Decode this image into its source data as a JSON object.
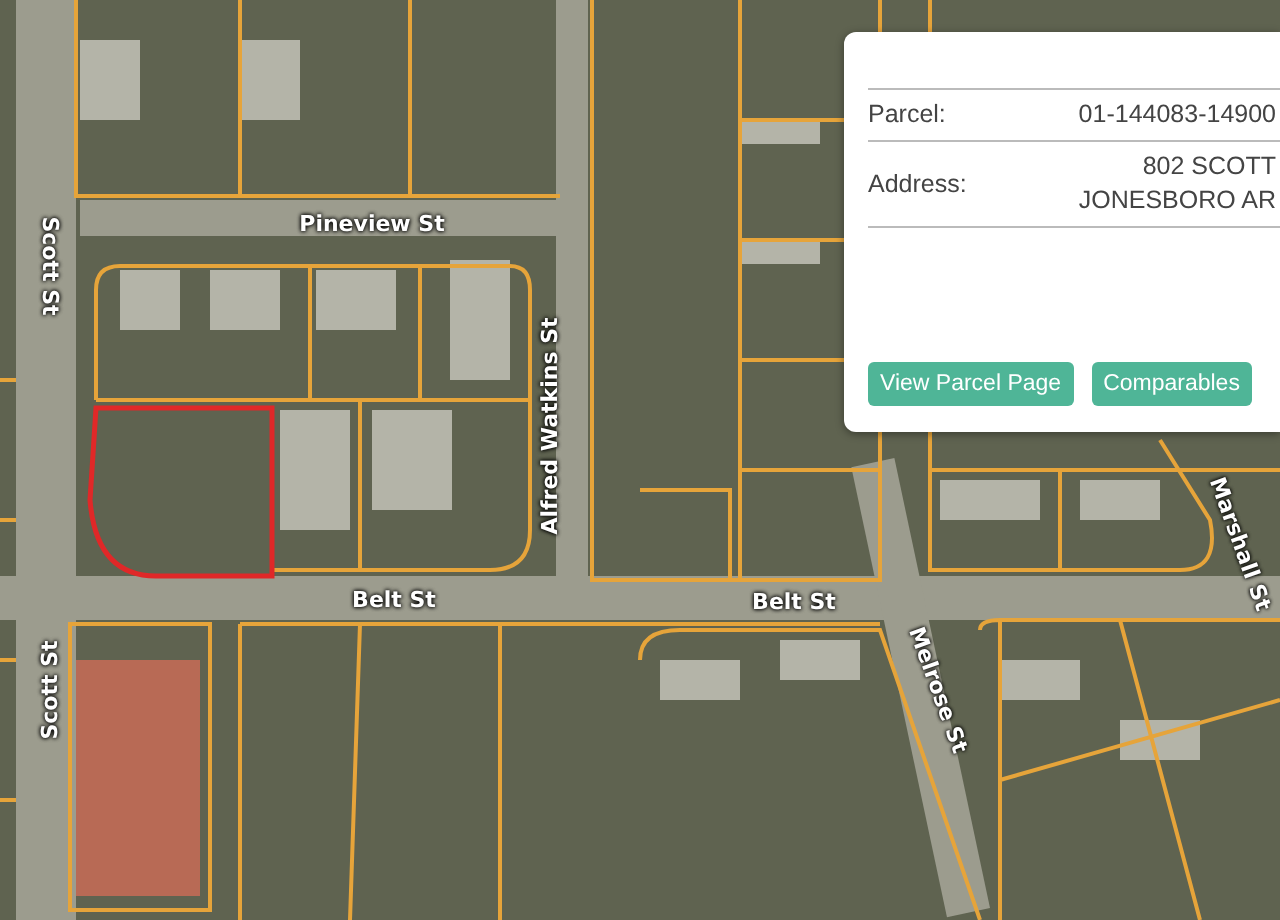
{
  "map": {
    "street_labels": [
      {
        "text": "Scott St"
      },
      {
        "text": "Pineview St"
      },
      {
        "text": "Alfred Watkins St"
      },
      {
        "text": "Belt St"
      },
      {
        "text": "Belt St"
      },
      {
        "text": "Melrose St"
      },
      {
        "text": "Marshall St"
      },
      {
        "text": "Scott St"
      }
    ]
  },
  "popup": {
    "rows": [
      {
        "label": "Parcel:",
        "value_lines": [
          "01-144083-14900"
        ]
      },
      {
        "label": "Address:",
        "value_lines": [
          "802 SCOTT",
          "JONESBORO AR"
        ]
      }
    ],
    "buttons": [
      "View Parcel Page",
      "Comparables"
    ]
  }
}
